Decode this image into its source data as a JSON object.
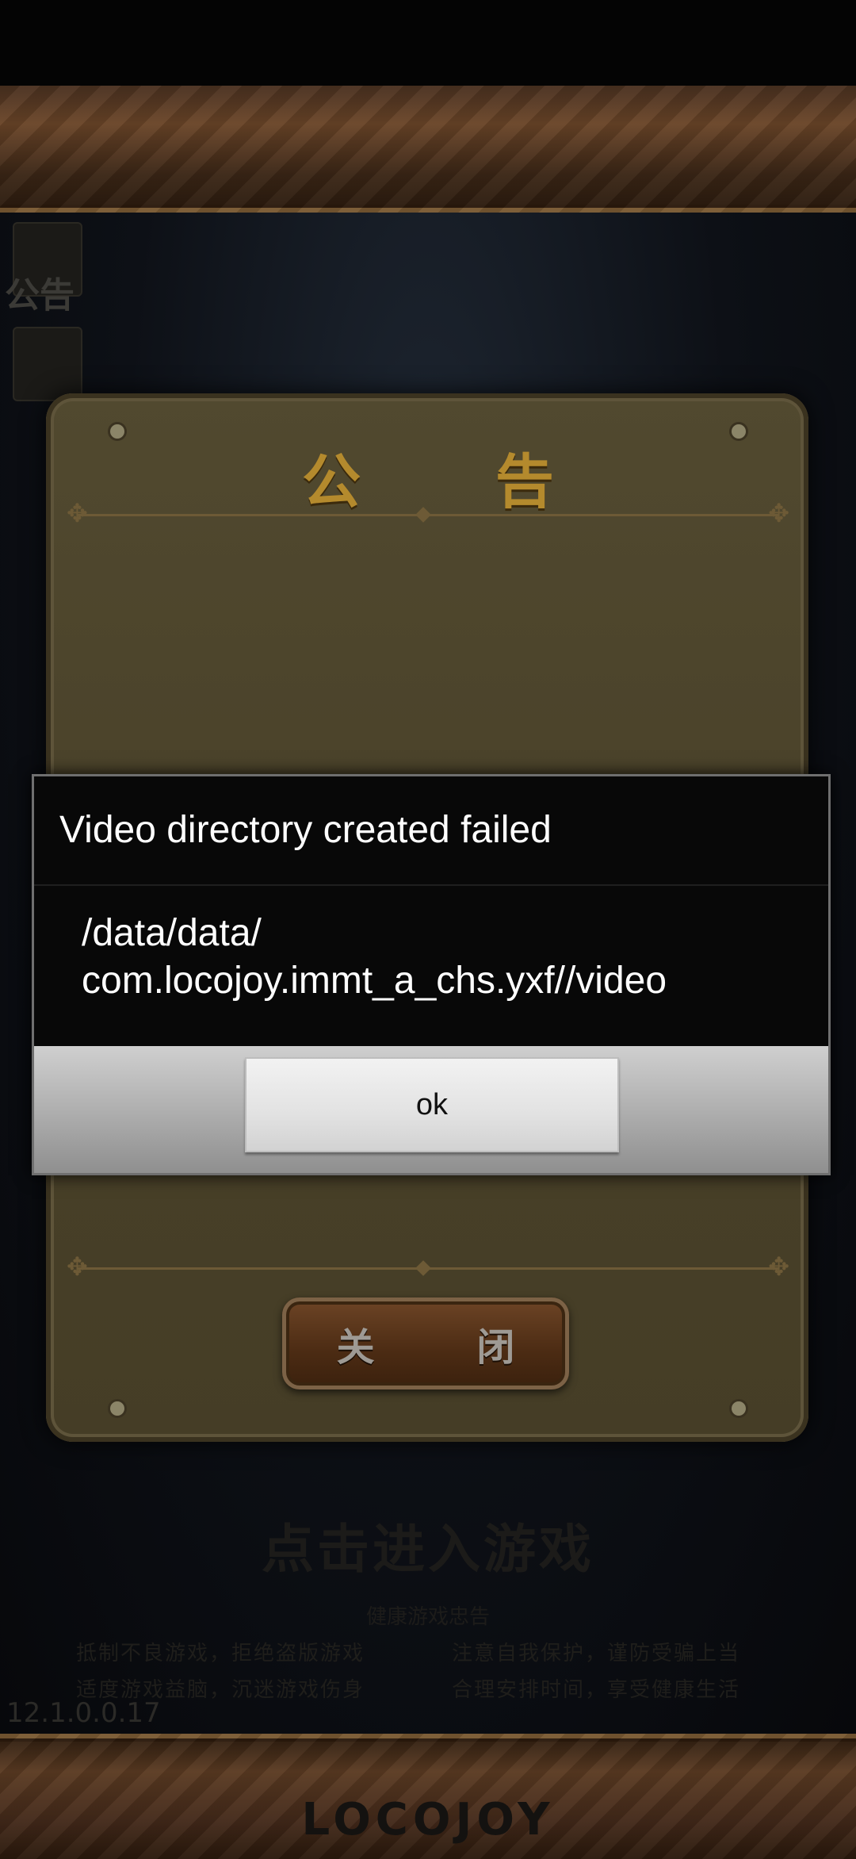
{
  "announcement": {
    "title": "公 告",
    "close_label": "关 闭"
  },
  "sidebar": {
    "notice_label": "公告"
  },
  "lobby": {
    "enter_game": "点击进入游戏",
    "health_title": "健康游戏忠告",
    "health_lines": [
      "抵制不良游戏，拒绝盗版游戏",
      "注意自我保护，谨防受骗上当",
      "适度游戏益脑，沉迷游戏伤身",
      "合理安排时间，享受健康生活"
    ],
    "version": "12.1.0.0.17",
    "brand": "LOCOJOY"
  },
  "dialog": {
    "title": "Video directory created failed",
    "message_line1": "/data/data/",
    "message_line2": "com.locojoy.immt_a_chs.yxf//video",
    "ok_label": "ok"
  }
}
